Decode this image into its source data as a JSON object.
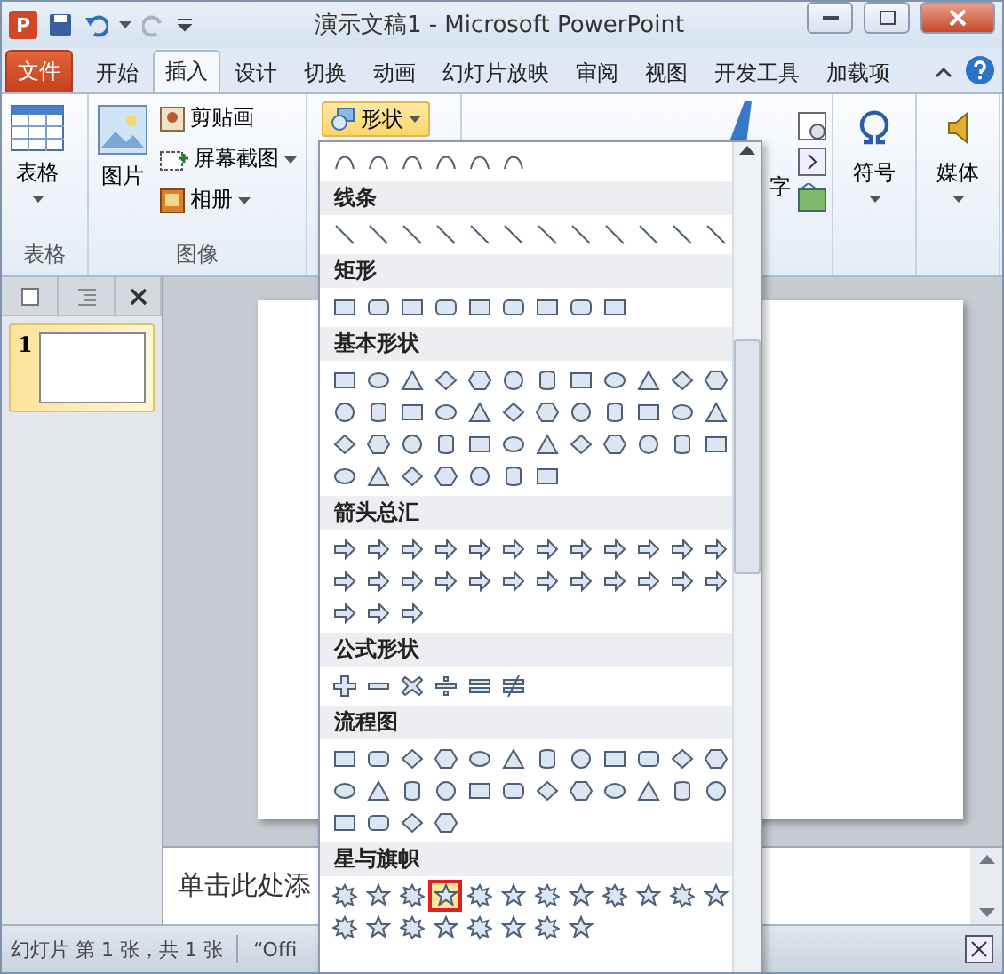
{
  "window": {
    "title": "演示文稿1 - Microsoft PowerPoint",
    "app_icon": "P"
  },
  "tabs": [
    {
      "label": "文件",
      "kind": "file",
      "selected": false
    },
    {
      "label": "开始",
      "selected": false
    },
    {
      "label": "插入",
      "selected": true
    },
    {
      "label": "设计",
      "selected": false
    },
    {
      "label": "切换",
      "selected": false
    },
    {
      "label": "动画",
      "selected": false
    },
    {
      "label": "幻灯片放映",
      "selected": false
    },
    {
      "label": "审阅",
      "selected": false
    },
    {
      "label": "视图",
      "selected": false
    },
    {
      "label": "开发工具",
      "selected": false
    },
    {
      "label": "加载项",
      "selected": false
    }
  ],
  "ribbon": {
    "table_group": {
      "label": "表格",
      "button": "表格"
    },
    "image_group": {
      "label": "图像",
      "picture": "图片",
      "clip_art": "剪贴画",
      "screenshot": "屏幕截图",
      "album": "相册"
    },
    "shapes_button": {
      "label": "形状",
      "expanded": true
    },
    "text_group": {
      "partial_label": "字"
    },
    "symbol": "符号",
    "media": "媒体"
  },
  "slides_pane": {
    "thumbnails": [
      {
        "number": "1",
        "selected": true
      }
    ]
  },
  "notes": {
    "placeholder": "单击此处添"
  },
  "status_bar": {
    "slide_info": "幻灯片 第 1 张，共 1 张",
    "theme": "“Offi"
  },
  "shapes_menu": {
    "sections": [
      {
        "kind": "curves",
        "shapes": [
          {
            "selected": false
          },
          {
            "selected": false
          },
          {
            "selected": false
          },
          {
            "selected": false
          },
          {
            "selected": false
          },
          {
            "selected": false
          }
        ]
      },
      {
        "title": "线条",
        "kind": "lines",
        "shapes": [
          {
            "selected": false
          },
          {
            "selected": false
          },
          {
            "selected": false
          },
          {
            "selected": false
          },
          {
            "selected": false
          },
          {
            "selected": false
          },
          {
            "selected": false
          },
          {
            "selected": false
          },
          {
            "selected": false
          },
          {
            "selected": false
          },
          {
            "selected": false
          },
          {
            "selected": false
          }
        ]
      },
      {
        "title": "矩形",
        "kind": "rects",
        "shapes": [
          {
            "selected": false
          },
          {
            "selected": false
          },
          {
            "selected": false
          },
          {
            "selected": false
          },
          {
            "selected": false
          },
          {
            "selected": false
          },
          {
            "selected": false
          },
          {
            "selected": false
          },
          {
            "selected": false
          }
        ]
      },
      {
        "title": "基本形状",
        "kind": "basic",
        "shapes": [
          {
            "selected": false
          },
          {
            "selected": false
          },
          {
            "selected": false
          },
          {
            "selected": false
          },
          {
            "selected": false
          },
          {
            "selected": false
          },
          {
            "selected": false
          },
          {
            "selected": false
          },
          {
            "selected": false
          },
          {
            "selected": false
          },
          {
            "selected": false
          },
          {
            "selected": false
          },
          {
            "selected": false
          },
          {
            "selected": false
          },
          {
            "selected": false
          },
          {
            "selected": false
          },
          {
            "selected": false
          },
          {
            "selected": false
          },
          {
            "selected": false
          },
          {
            "selected": false
          },
          {
            "selected": false
          },
          {
            "selected": false
          },
          {
            "selected": false
          },
          {
            "selected": false
          },
          {
            "selected": false
          },
          {
            "selected": false
          },
          {
            "selected": false
          },
          {
            "selected": false
          },
          {
            "selected": false
          },
          {
            "selected": false
          },
          {
            "selected": false
          },
          {
            "selected": false
          },
          {
            "selected": false
          },
          {
            "selected": false
          },
          {
            "selected": false
          },
          {
            "selected": false
          },
          {
            "selected": false
          },
          {
            "selected": false
          },
          {
            "selected": false
          },
          {
            "selected": false
          },
          {
            "selected": false
          },
          {
            "selected": false
          },
          {
            "selected": false
          }
        ]
      },
      {
        "title": "箭头总汇",
        "kind": "arrows",
        "shapes": [
          {
            "selected": false
          },
          {
            "selected": false
          },
          {
            "selected": false
          },
          {
            "selected": false
          },
          {
            "selected": false
          },
          {
            "selected": false
          },
          {
            "selected": false
          },
          {
            "selected": false
          },
          {
            "selected": false
          },
          {
            "selected": false
          },
          {
            "selected": false
          },
          {
            "selected": false
          },
          {
            "selected": false
          },
          {
            "selected": false
          },
          {
            "selected": false
          },
          {
            "selected": false
          },
          {
            "selected": false
          },
          {
            "selected": false
          },
          {
            "selected": false
          },
          {
            "selected": false
          },
          {
            "selected": false
          },
          {
            "selected": false
          },
          {
            "selected": false
          },
          {
            "selected": false
          },
          {
            "selected": false
          },
          {
            "selected": false
          },
          {
            "selected": false
          }
        ]
      },
      {
        "title": "公式形状",
        "kind": "math",
        "shapes": [
          {
            "selected": false
          },
          {
            "selected": false
          },
          {
            "selected": false
          },
          {
            "selected": false
          },
          {
            "selected": false
          },
          {
            "selected": false
          }
        ]
      },
      {
        "title": "流程图",
        "kind": "flow",
        "shapes": [
          {
            "selected": false
          },
          {
            "selected": false
          },
          {
            "selected": false
          },
          {
            "selected": false
          },
          {
            "selected": false
          },
          {
            "selected": false
          },
          {
            "selected": false
          },
          {
            "selected": false
          },
          {
            "selected": false
          },
          {
            "selected": false
          },
          {
            "selected": false
          },
          {
            "selected": false
          },
          {
            "selected": false
          },
          {
            "selected": false
          },
          {
            "selected": false
          },
          {
            "selected": false
          },
          {
            "selected": false
          },
          {
            "selected": false
          },
          {
            "selected": false
          },
          {
            "selected": false
          },
          {
            "selected": false
          },
          {
            "selected": false
          },
          {
            "selected": false
          },
          {
            "selected": false
          },
          {
            "selected": false
          },
          {
            "selected": false
          },
          {
            "selected": false
          },
          {
            "selected": false
          }
        ]
      },
      {
        "title": "星与旗帜",
        "kind": "stars",
        "shapes": [
          {
            "selected": false
          },
          {
            "selected": false
          },
          {
            "selected": false
          },
          {
            "selected": true
          },
          {
            "selected": false
          },
          {
            "selected": false
          },
          {
            "selected": false
          },
          {
            "selected": false
          },
          {
            "selected": false
          },
          {
            "selected": false
          },
          {
            "selected": false
          },
          {
            "selected": false
          },
          {
            "selected": false
          },
          {
            "selected": false
          },
          {
            "selected": false
          },
          {
            "selected": false
          },
          {
            "selected": false
          },
          {
            "selected": false
          },
          {
            "selected": false
          },
          {
            "selected": false
          }
        ]
      }
    ]
  }
}
